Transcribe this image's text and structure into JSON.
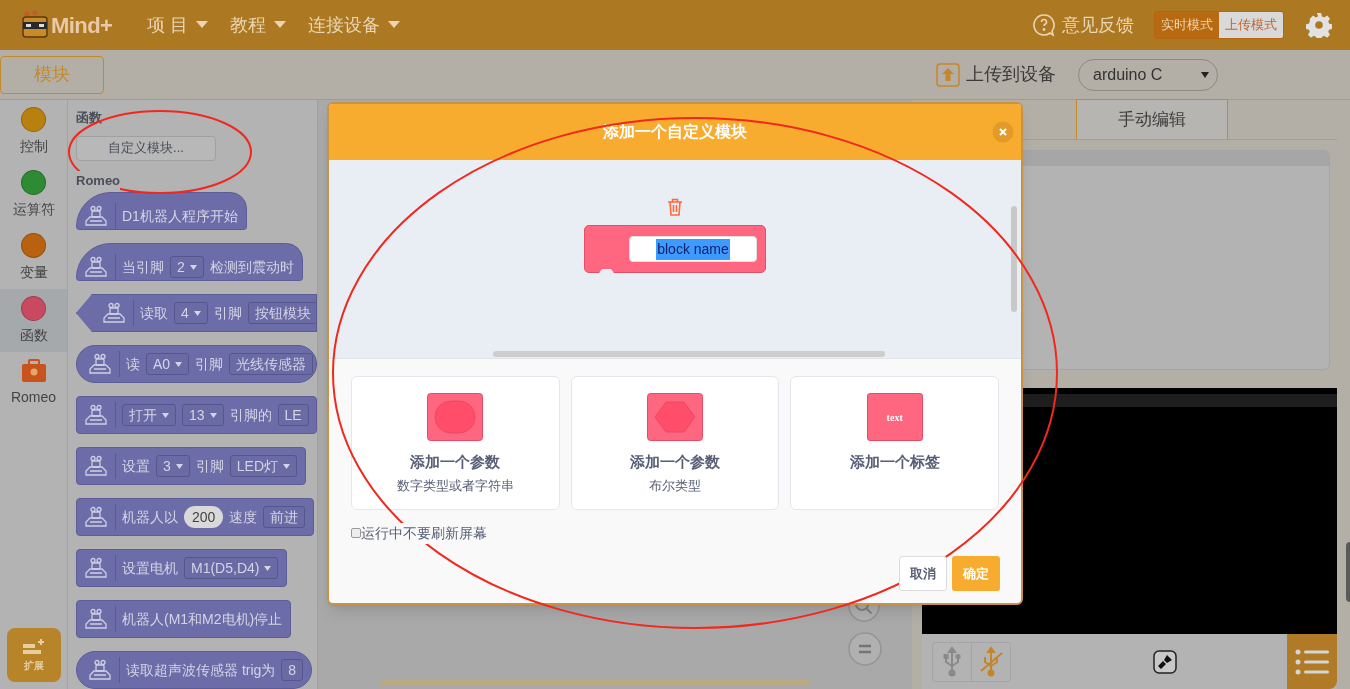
{
  "menu_bar": {
    "logo": "Mind+",
    "menus": [
      "项 目",
      "教程",
      "连接设备"
    ],
    "feedback": "意见反馈",
    "modes": [
      {
        "label": "实时模式",
        "selected": false
      },
      {
        "label": "上传模式",
        "selected": true
      }
    ]
  },
  "toolbar": {
    "tabs": [
      {
        "label": "模块",
        "selected": true
      }
    ],
    "upload": "上传到设备",
    "device": "arduino C"
  },
  "categories": [
    {
      "label": "控制",
      "kind": "dot",
      "color": "#b8800f",
      "selected": false
    },
    {
      "label": "运算符",
      "kind": "dot",
      "color": "#2e8a34",
      "selected": false
    },
    {
      "label": "变量",
      "kind": "dot",
      "color": "#b8620f",
      "selected": false
    },
    {
      "label": "函数",
      "kind": "dot",
      "color": "#c94a60",
      "selected": true
    },
    {
      "label": "Romeo",
      "kind": "toolbox",
      "color": "#c8531c",
      "selected": false
    }
  ],
  "extension_button": "扩展",
  "palette": {
    "section": "函数",
    "make_block": "自定义模块...",
    "section_2": "Romeo",
    "blocks": [
      {
        "kind": "hat",
        "parts": [
          {
            "kind": "text",
            "text": "D1机器人程序开始"
          }
        ]
      },
      {
        "kind": "hat",
        "parts": [
          {
            "kind": "text",
            "text": "当引脚"
          },
          {
            "kind": "dropdown",
            "text": "2"
          },
          {
            "kind": "text",
            "text": "检测到震动时"
          }
        ]
      },
      {
        "kind": "boolean",
        "parts": [
          {
            "kind": "text",
            "text": "读取"
          },
          {
            "kind": "dropdown",
            "text": "4"
          },
          {
            "kind": "text",
            "text": "引脚"
          },
          {
            "kind": "field",
            "text": "按钮模块"
          }
        ]
      },
      {
        "kind": "reporter",
        "parts": [
          {
            "kind": "text",
            "text": "读"
          },
          {
            "kind": "dropdown",
            "text": "A0"
          },
          {
            "kind": "text",
            "text": "引脚"
          },
          {
            "kind": "field",
            "text": "光线传感器"
          }
        ]
      },
      {
        "kind": "command",
        "parts": [
          {
            "kind": "dropdown",
            "text": "打开"
          },
          {
            "kind": "dropdown",
            "text": "13"
          },
          {
            "kind": "text",
            "text": "引脚的"
          },
          {
            "kind": "field",
            "text": "LE"
          }
        ]
      },
      {
        "kind": "command",
        "parts": [
          {
            "kind": "text",
            "text": "设置"
          },
          {
            "kind": "dropdown",
            "text": "3"
          },
          {
            "kind": "text",
            "text": "引脚"
          },
          {
            "kind": "dropdown",
            "text": "LED灯"
          }
        ]
      },
      {
        "kind": "command",
        "parts": [
          {
            "kind": "text",
            "text": "机器人以"
          },
          {
            "kind": "number",
            "text": "200"
          },
          {
            "kind": "text",
            "text": "速度"
          },
          {
            "kind": "field",
            "text": "前进"
          }
        ]
      },
      {
        "kind": "command",
        "parts": [
          {
            "kind": "text",
            "text": "设置电机"
          },
          {
            "kind": "dropdown",
            "text": "M1(D5,D4)"
          }
        ]
      },
      {
        "kind": "command",
        "parts": [
          {
            "kind": "text",
            "text": "机器人(M1和M2电机)停止"
          }
        ]
      },
      {
        "kind": "reporter",
        "parts": [
          {
            "kind": "text",
            "text": "读取超声波传感器 trig为"
          },
          {
            "kind": "field",
            "text": "8"
          }
        ]
      }
    ]
  },
  "code_panel": {
    "tabs": [
      {
        "label": "手动编辑",
        "selected": true
      }
    ]
  },
  "dialog": {
    "title": "添加一个自定义模块",
    "block_name": "block name",
    "options": [
      {
        "kind": "round",
        "title": "添加一个参数",
        "subtitle": "数字类型或者字符串"
      },
      {
        "kind": "boolean",
        "title": "添加一个参数",
        "subtitle": "布尔类型"
      },
      {
        "kind": "label",
        "title": "添加一个标签",
        "icon_text": "text"
      }
    ],
    "checkbox": {
      "label": "运行中不要刷新屏幕",
      "checked": false
    },
    "buttons": [
      {
        "label": "取消",
        "kind": "secondary"
      },
      {
        "label": "确定",
        "kind": "primary"
      }
    ]
  }
}
